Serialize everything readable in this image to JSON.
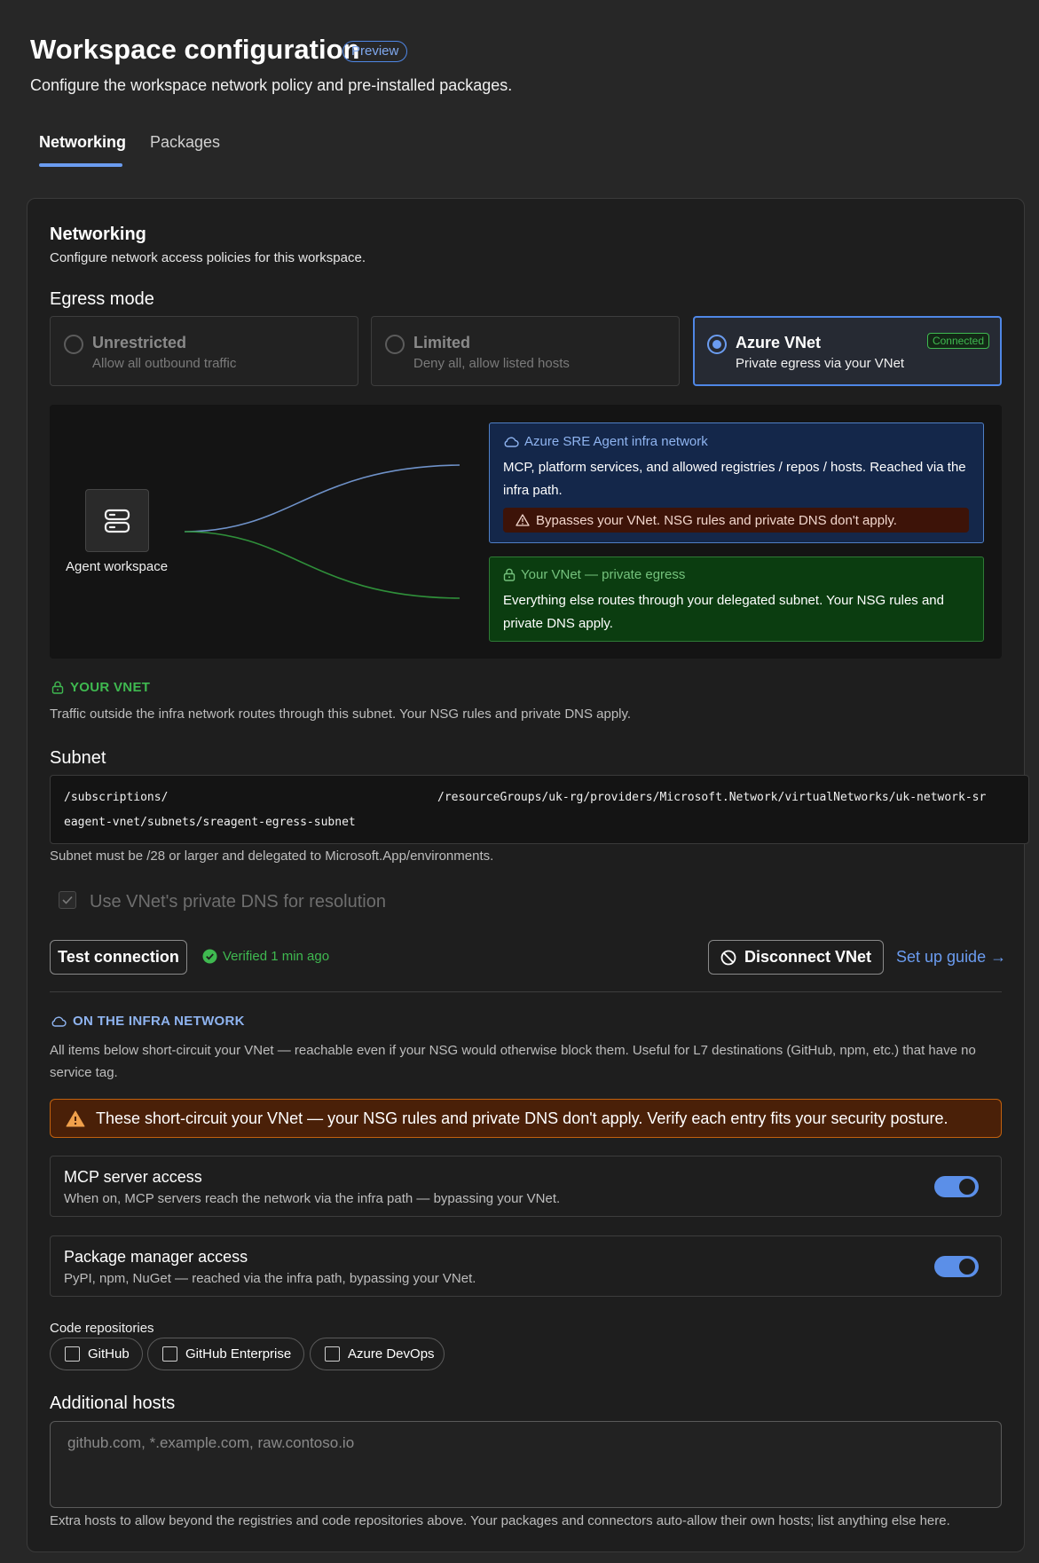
{
  "header": {
    "title": "Workspace configuration",
    "badge": "Preview",
    "subtitle": "Configure the workspace network policy and pre-installed packages."
  },
  "tabs": [
    {
      "label": "Networking",
      "active": true
    },
    {
      "label": "Packages",
      "active": false
    }
  ],
  "networking": {
    "title": "Networking",
    "subtitle": "Configure network access policies for this workspace.",
    "egress_label": "Egress mode",
    "modes": [
      {
        "title": "Unrestricted",
        "desc": "Allow all outbound traffic",
        "selected": false
      },
      {
        "title": "Limited",
        "desc": "Deny all, allow listed hosts",
        "selected": false
      },
      {
        "title": "Azure VNet",
        "desc": "Private egress via your VNet",
        "selected": true,
        "badge": "Connected"
      }
    ]
  },
  "diagram": {
    "workspace_label": "Agent workspace",
    "infra": {
      "title": "Azure SRE Agent infra network",
      "text": "MCP, platform services, and allowed registries / repos / hosts. Reached via the infra path.",
      "warning": "Bypasses your VNet. NSG rules and private DNS don't apply."
    },
    "vnet": {
      "title": "Your VNet — private egress",
      "text": "Everything else routes through your delegated subnet. Your NSG rules and private DNS apply."
    }
  },
  "your_vnet": {
    "heading": "YOUR VNET",
    "desc": "Traffic outside the infra network routes through this subnet. Your NSG rules and private DNS apply.",
    "subnet_label": "Subnet",
    "subnet_line1a": "/subscriptions/",
    "subnet_line1b": "/resourceGroups/uk-rg/providers/Microsoft.Network/virtualNetworks/uk-network-sr",
    "subnet_line2": "eagent-vnet/subnets/sreagent-egress-subnet",
    "subnet_help": "Subnet must be /28 or larger and delegated to Microsoft.App/environments.",
    "dns_label": "Use VNet's private DNS for resolution",
    "dns_checked": true,
    "test_button": "Test connection",
    "verified": "Verified 1 min ago",
    "disconnect_button": "Disconnect VNet",
    "guide_link": "Set up guide →"
  },
  "infra_network": {
    "heading": "ON THE INFRA NETWORK",
    "desc": "All items below short-circuit your VNet — reachable even if your NSG would otherwise block them. Useful for L7 destinations (GitHub, npm, etc.) that have no service tag.",
    "warning": "These short-circuit your VNet — your NSG rules and private DNS don't apply. Verify each entry fits your security posture.",
    "toggles": [
      {
        "title": "MCP server access",
        "desc": "When on, MCP servers reach the network via the infra path — bypassing your VNet.",
        "on": true
      },
      {
        "title": "Package manager access",
        "desc": "PyPI, npm, NuGet — reached via the infra path, bypassing your VNet.",
        "on": true
      }
    ],
    "repos_label": "Code repositories",
    "repos": [
      {
        "label": "GitHub",
        "checked": false
      },
      {
        "label": "GitHub Enterprise",
        "checked": false
      },
      {
        "label": "Azure DevOps",
        "checked": false
      }
    ],
    "hosts_label": "Additional hosts",
    "hosts_placeholder": "github.com, *.example.com, raw.contoso.io",
    "hosts_help": "Extra hosts to allow beyond the registries and code repositories above. Your packages and connectors auto-allow their own hosts; list anything else here."
  },
  "colors": {
    "accent": "#6b9cf0",
    "success": "#3fb950",
    "warning": "#c2610e",
    "infra_bg": "#14274a",
    "vnet_bg": "#0b3d10"
  }
}
